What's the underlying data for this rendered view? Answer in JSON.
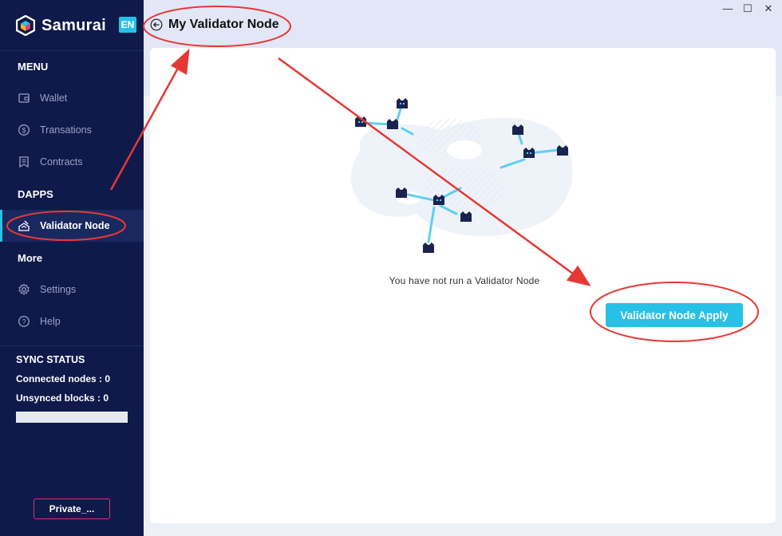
{
  "sidebar": {
    "brand": "Samurai",
    "lang": "EN",
    "menu_title": "MENU",
    "menu_items": [
      {
        "label": "Wallet",
        "icon": "wallet-icon"
      },
      {
        "label": "Transations",
        "icon": "dollar-icon"
      },
      {
        "label": "Contracts",
        "icon": "contract-icon"
      }
    ],
    "dapps_title": "DAPPS",
    "dapps_items": [
      {
        "label": "Validator Node",
        "icon": "validator-icon",
        "active": true
      }
    ],
    "more_title": "More",
    "more_items": [
      {
        "label": "Settings",
        "icon": "gear-icon"
      },
      {
        "label": "Help",
        "icon": "help-icon"
      }
    ],
    "sync": {
      "title": "SYNC STATUS",
      "connected_nodes": "Connected nodes : 0",
      "unsynced_blocks": "Unsynced blocks : 0",
      "progress": 0
    },
    "network_button": "Private_..."
  },
  "header": {
    "title": "My Validator Node",
    "window_controls": [
      "—",
      "☐",
      "✕"
    ]
  },
  "main": {
    "empty_text": "You have not run a Validator Node",
    "apply_button": "Validator Node Apply"
  },
  "colors": {
    "sidebar_bg": "#0f1a4a",
    "accent": "#27c0e6",
    "annotation": "#e53935"
  }
}
